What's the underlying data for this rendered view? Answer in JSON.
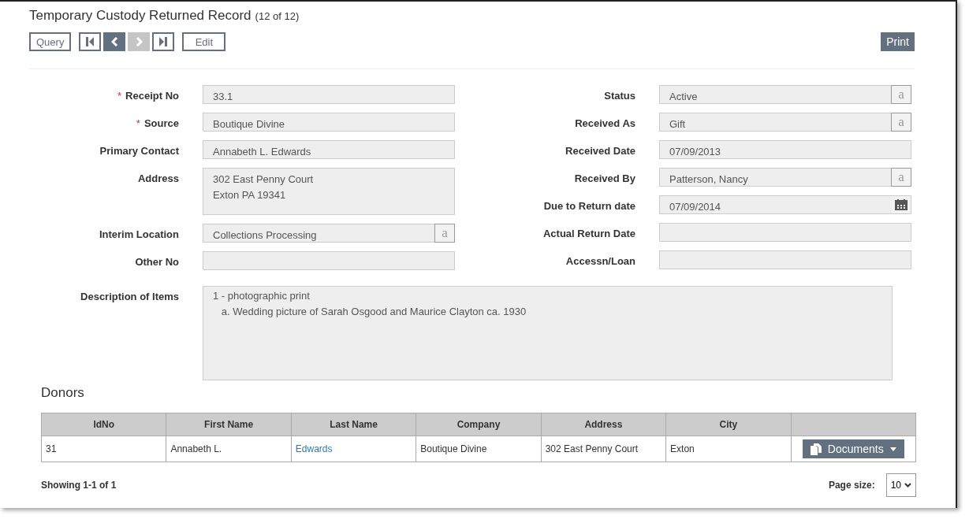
{
  "page": {
    "title": "Temporary Custody Returned Record",
    "counter": "(12 of 12)"
  },
  "toolbar": {
    "query": "Query",
    "nav": [
      {
        "kind": "first",
        "disabled": false
      },
      {
        "kind": "prev",
        "disabled": false
      },
      {
        "kind": "next",
        "disabled": true
      },
      {
        "kind": "last",
        "disabled": false
      }
    ],
    "edit": "Edit",
    "print": "Print"
  },
  "left_fields": [
    {
      "label": "Receipt No",
      "required_mark": "*",
      "kind": "text",
      "value": "33.1"
    },
    {
      "label": "Source",
      "required_mark": "*",
      "kind": "text",
      "value": "Boutique Divine"
    },
    {
      "label": "Primary Contact",
      "kind": "text",
      "value": "Annabeth L. Edwards"
    },
    {
      "label": "Address",
      "kind": "textarea",
      "value": "302 East Penny Court\nExton PA 19341"
    },
    {
      "label": "Interim Location",
      "kind": "lookup",
      "value": "Collections Processing",
      "button": "a"
    },
    {
      "label": "Other No",
      "kind": "text"
    }
  ],
  "right_fields": [
    {
      "label": "Status",
      "kind": "lookup",
      "value": "Active",
      "button": "a"
    },
    {
      "label": "Received As",
      "kind": "lookup",
      "value": "Gift",
      "button": "a"
    },
    {
      "label": "Received Date",
      "kind": "text",
      "value": "07/09/2013"
    },
    {
      "label": "Received By",
      "kind": "lookup",
      "value": "Patterson, Nancy",
      "button": "a"
    },
    {
      "label": "Due to Return date",
      "kind": "date",
      "value": "07/09/2014"
    },
    {
      "label": "Actual Return Date",
      "kind": "text"
    },
    {
      "label": "Accessn/Loan",
      "kind": "text"
    }
  ],
  "description": {
    "label": "Description of Items",
    "value": "1 - photographic print\n   a. Wedding picture of Sarah Osgood and Maurice Clayton ca. 1930"
  },
  "donors": {
    "title": "Donors",
    "columns": [
      "IdNo",
      "First Name",
      "Last Name",
      "Company",
      "Address",
      "City"
    ],
    "rows": [
      {
        "cells": [
          {
            "kind": "text",
            "text": "31"
          },
          {
            "kind": "text",
            "text": "Annabeth L."
          },
          {
            "kind": "link",
            "text": "Edwards"
          },
          {
            "kind": "text",
            "text": "Boutique Divine"
          },
          {
            "kind": "text",
            "text": "302 East Penny Court"
          },
          {
            "kind": "text",
            "text": "Exton"
          }
        ],
        "action": "Documents"
      }
    ],
    "showing": "Showing 1-1 of 1",
    "page_size_label": "Page size:",
    "page_size": "10"
  }
}
